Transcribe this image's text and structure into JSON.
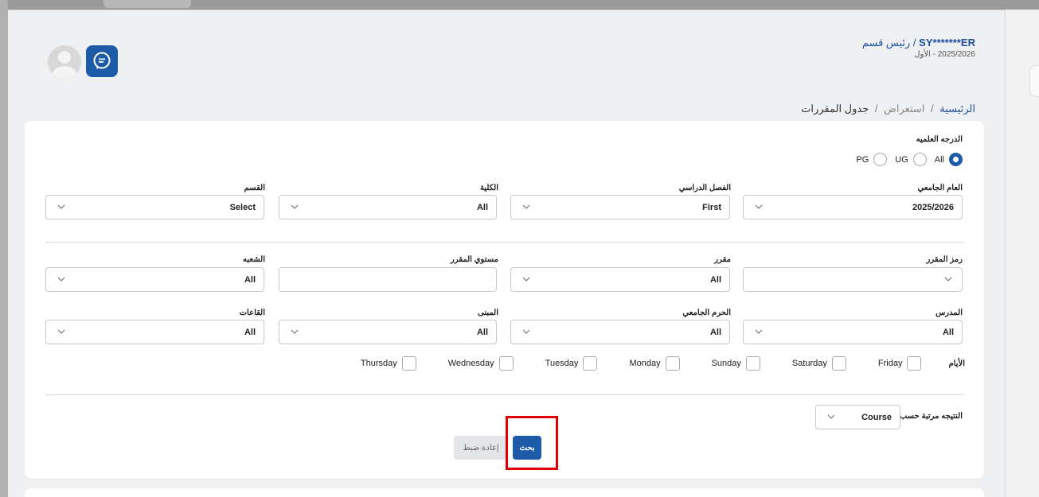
{
  "header": {
    "user_name": "SY*******ER",
    "role": "/ رئيس قسم",
    "term": "2025/2026 - الأول",
    "avatar_icon": "user-avatar-icon",
    "chat_icon": "chat-icon"
  },
  "breadcrumb": {
    "home": "الرئيسية",
    "sep1": "/",
    "mid": "استعراض",
    "sep2": "/",
    "current": "جدول المقررات"
  },
  "filters": {
    "degree": {
      "label": "الدرجه العلميه",
      "options": [
        "All",
        "UG",
        "PG"
      ],
      "selected": "All"
    },
    "academic_year": {
      "label": "العام الجامعي",
      "value": "2025/2026"
    },
    "semester": {
      "label": "الفصل الدراسي",
      "value": "First"
    },
    "college": {
      "label": "الكلية",
      "value": "All"
    },
    "department": {
      "label": "القسم",
      "value": "Select"
    },
    "course_code": {
      "label": "رمز المقرر",
      "value": ""
    },
    "course": {
      "label": "مقرر",
      "value": "All"
    },
    "course_level": {
      "label": "مستوي المقرر",
      "value": ""
    },
    "section": {
      "label": "الشعبه",
      "value": "All"
    },
    "instructor": {
      "label": "المدرس",
      "value": "All"
    },
    "campus": {
      "label": "الحرم الجامعي",
      "value": "All"
    },
    "building": {
      "label": "المبنى",
      "value": "All"
    },
    "rooms": {
      "label": "القاعات",
      "value": "All"
    },
    "days": {
      "label": "الأيام",
      "items": [
        "Friday",
        "Saturday",
        "Sunday",
        "Monday",
        "Tuesday",
        "Wednesday",
        "Thursday"
      ]
    },
    "sort_by": {
      "label": "النتيجه مرتبة حسب",
      "value": "Course"
    }
  },
  "actions": {
    "search_label": "بحث",
    "reset_label": "إعادة ضبط"
  },
  "colors": {
    "primary": "#1d5ba8",
    "highlight": "#e00000"
  }
}
